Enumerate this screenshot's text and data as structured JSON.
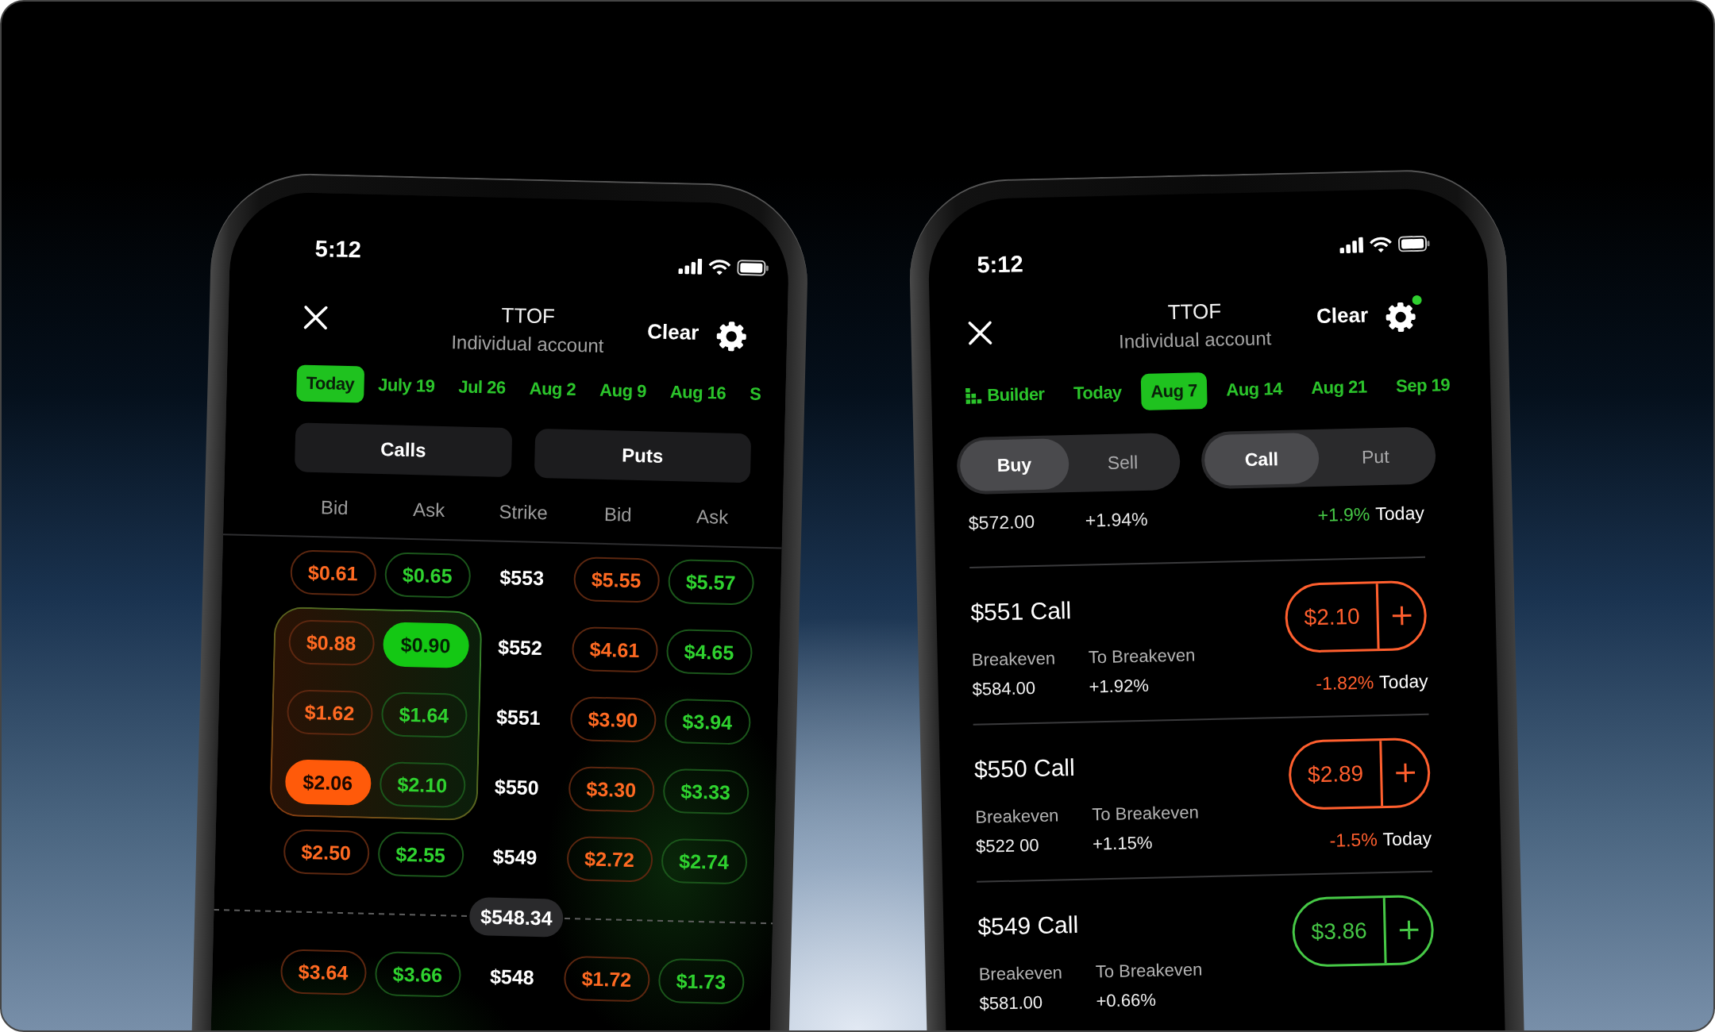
{
  "chain_screen": {
    "status_bar": {
      "time": "5:12"
    },
    "header": {
      "title": "TTOF",
      "subtitle": "Individual account",
      "action": "Clear",
      "settings_dot": false
    },
    "expiry_tabs": [
      {
        "label": "Today",
        "selected": true
      },
      {
        "label": "July 19",
        "selected": false
      },
      {
        "label": "Jul 26",
        "selected": false
      },
      {
        "label": "Aug 2",
        "selected": false
      },
      {
        "label": "Aug 9",
        "selected": false
      },
      {
        "label": "Aug 16",
        "selected": false
      },
      {
        "label": "S",
        "selected": false
      }
    ],
    "sections": [
      "Calls",
      "Puts"
    ],
    "columns": [
      "Bid",
      "Ask",
      "Strike",
      "Bid",
      "Ask"
    ],
    "rows": [
      {
        "kind": "strike",
        "strike": "$553",
        "in_strategy": false,
        "call_bid": {
          "price": "$0.61",
          "selected": false
        },
        "call_ask": {
          "price": "$0.65",
          "selected": false
        },
        "put_bid": {
          "price": "$5.55",
          "selected": false
        },
        "put_ask": {
          "price": "$5.57",
          "selected": false
        }
      },
      {
        "kind": "strike",
        "strike": "$552",
        "in_strategy": true,
        "call_bid": {
          "price": "$0.88",
          "selected": false
        },
        "call_ask": {
          "price": "$0.90",
          "selected": true
        },
        "put_bid": {
          "price": "$4.61",
          "selected": false
        },
        "put_ask": {
          "price": "$4.65",
          "selected": false
        }
      },
      {
        "kind": "strike",
        "strike": "$551",
        "in_strategy": true,
        "call_bid": {
          "price": "$1.62",
          "selected": false
        },
        "call_ask": {
          "price": "$1.64",
          "selected": false
        },
        "put_bid": {
          "price": "$3.90",
          "selected": false
        },
        "put_ask": {
          "price": "$3.94",
          "selected": false
        }
      },
      {
        "kind": "strike",
        "strike": "$550",
        "in_strategy": true,
        "call_bid": {
          "price": "$2.06",
          "selected": true
        },
        "call_ask": {
          "price": "$2.10",
          "selected": false
        },
        "put_bid": {
          "price": "$3.30",
          "selected": false
        },
        "put_ask": {
          "price": "$3.33",
          "selected": false
        }
      },
      {
        "kind": "strike",
        "strike": "$549",
        "in_strategy": false,
        "call_bid": {
          "price": "$2.50",
          "selected": false
        },
        "call_ask": {
          "price": "$2.55",
          "selected": false
        },
        "put_bid": {
          "price": "$2.72",
          "selected": false
        },
        "put_ask": {
          "price": "$2.74",
          "selected": false
        }
      },
      {
        "kind": "price_line",
        "price": "$548.34"
      },
      {
        "kind": "strike",
        "strike": "$548",
        "in_strategy": false,
        "call_bid": {
          "price": "$3.64",
          "selected": false
        },
        "call_ask": {
          "price": "$3.66",
          "selected": false
        },
        "put_bid": {
          "price": "$1.72",
          "selected": false
        },
        "put_ask": {
          "price": "$1.73",
          "selected": false
        }
      }
    ]
  },
  "builder_screen": {
    "status_bar": {
      "time": "5:12"
    },
    "header": {
      "title": "TTOF",
      "subtitle": "Individual account",
      "action": "Clear",
      "settings_dot": true
    },
    "expiry_tabs": [
      {
        "kind": "builder",
        "label": "Builder",
        "selected": false
      },
      {
        "kind": "date",
        "label": "Today",
        "selected": false
      },
      {
        "kind": "date",
        "label": "Aug 7",
        "selected": true
      },
      {
        "kind": "date",
        "label": "Aug 14",
        "selected": false
      },
      {
        "kind": "date",
        "label": "Aug 21",
        "selected": false
      },
      {
        "kind": "date",
        "label": "Sep 19",
        "selected": false
      }
    ],
    "side_toggle": [
      {
        "label": "Buy",
        "selected": true
      },
      {
        "label": "Sell",
        "selected": false
      }
    ],
    "type_toggle": [
      {
        "label": "Call",
        "selected": true
      },
      {
        "label": "Put",
        "selected": false
      }
    ],
    "underlying": {
      "price": "$572.00",
      "change": "+1.94%",
      "day_change": "+1.9%",
      "negative": false,
      "period": "Today"
    },
    "contracts": [
      {
        "title": "$551 Call",
        "breakeven_label": "Breakeven",
        "breakeven": "$584.00",
        "to_breakeven_label": "To Breakeven",
        "to_breakeven": "+1.92%",
        "price": "$2.10",
        "negative": true,
        "day_change": "-1.82%",
        "period": "Today"
      },
      {
        "title": "$550 Call",
        "breakeven_label": "Breakeven",
        "breakeven": "$522 00",
        "to_breakeven_label": "To Breakeven",
        "to_breakeven": "+1.15%",
        "price": "$2.89",
        "negative": true,
        "day_change": "-1.5%",
        "period": "Today"
      },
      {
        "title": "$549 Call",
        "breakeven_label": "Breakeven",
        "breakeven": "$581.00",
        "to_breakeven_label": "To Breakeven",
        "to_breakeven": "+0.66%",
        "price": "$3.86",
        "negative": false
      }
    ]
  }
}
